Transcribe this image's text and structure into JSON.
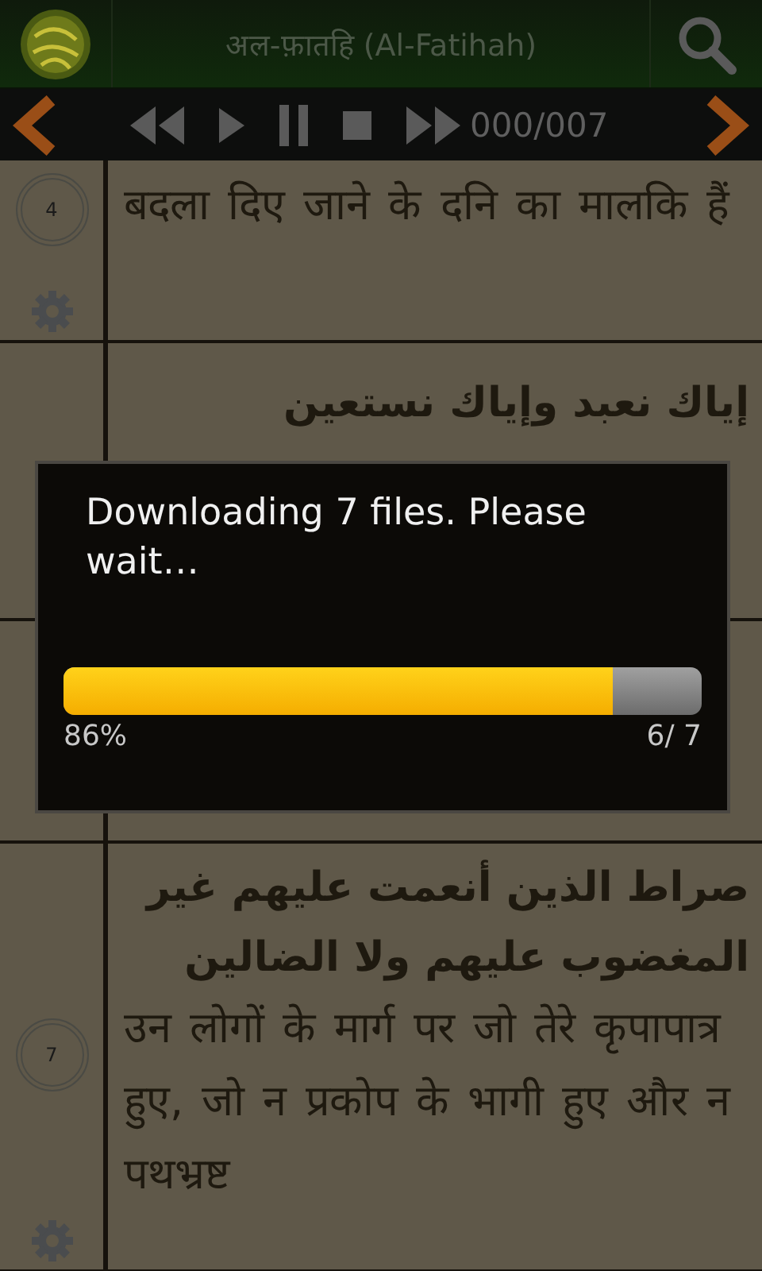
{
  "header": {
    "title": "अल-फ़ातहि (Al-Fatihah)"
  },
  "player": {
    "counter": "000/007"
  },
  "verses": [
    {
      "kind": "full",
      "number": "4",
      "translation": "बदला दिए जाने के दनि का मालकि हैं"
    },
    {
      "kind": "covered",
      "arabic": "إياك نعبد وإياك نستعين"
    },
    {
      "kind": "covered"
    },
    {
      "kind": "full",
      "number": "7",
      "arabic": "صراط الذين أنعمت عليهم غير المغضوب عليهم ولا الضالين",
      "translation": "उन लोगों के मार्ग पर जो तेरे कृपापात्र हुए, जो न प्रकोप के भागी हुए और न पथभ्रष्ट"
    }
  ],
  "dialog": {
    "message": "Downloading 7 files. Please wait…",
    "level": 0.86,
    "percent": "86%",
    "count": "6/ 7"
  }
}
